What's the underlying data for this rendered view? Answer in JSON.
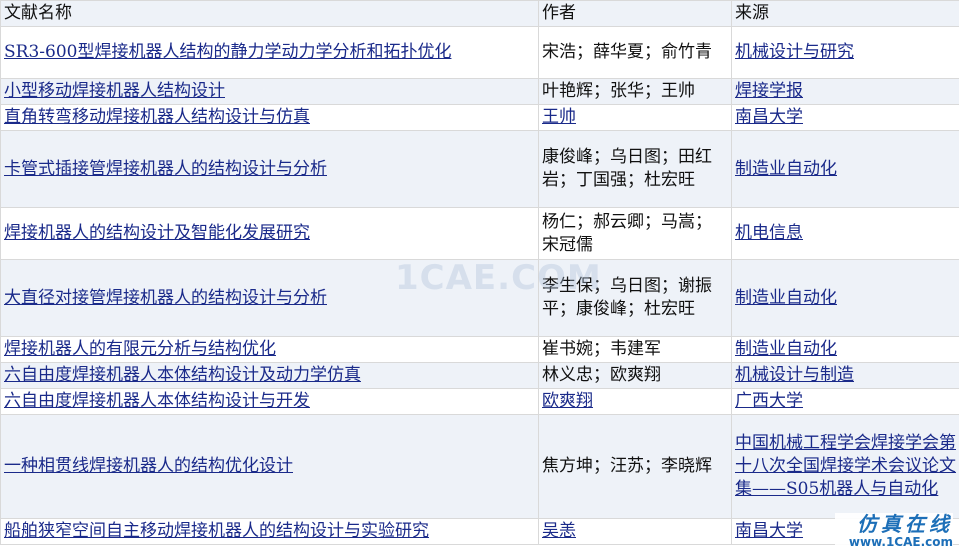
{
  "headers": {
    "title": "文献名称",
    "authors": "作者",
    "source": "来源"
  },
  "rows": [
    {
      "title": "SR3-600型焊接机器人结构的静力学动力学分析和拓扑优化",
      "authors": "宋浩；薛华夏；俞竹青",
      "source": "机械设计与研究"
    },
    {
      "title": "小型移动焊接机器人结构设计",
      "authors": "叶艳辉；张华；王帅",
      "source": "焊接学报"
    },
    {
      "title": "直角转弯移动焊接机器人结构设计与仿真",
      "authors": "王帅",
      "source": "南昌大学"
    },
    {
      "title": "卡管式插接管焊接机器人的结构设计与分析",
      "authors": "康俊峰；乌日图；田红岩；丁国强；杜宏旺",
      "source": "制造业自动化"
    },
    {
      "title": "焊接机器人的结构设计及智能化发展研究",
      "authors": "杨仁；郝云卿；马嵩；宋冠儒",
      "source": "机电信息"
    },
    {
      "title": "大直径对接管焊接机器人的结构设计与分析",
      "authors": "李生保；乌日图；谢振平；康俊峰；杜宏旺",
      "source": "制造业自动化"
    },
    {
      "title": "焊接机器人的有限元分析与结构优化",
      "authors": "崔书婉；韦建军",
      "source": "制造业自动化"
    },
    {
      "title": "六自由度焊接机器人本体结构设计及动力学仿真",
      "authors": "林义忠；欧爽翔",
      "source": "机械设计与制造"
    },
    {
      "title": "六自由度焊接机器人本体结构设计与开发",
      "authors": "欧爽翔",
      "source": "广西大学"
    },
    {
      "title": "一种相贯线焊接机器人的结构优化设计",
      "authors": "焦方坤；汪苏；李晓辉",
      "source": "中国机械工程学会焊接学会第十八次全国焊接学术会议论文集——S05机器人与自动化"
    },
    {
      "title": "船舶狭窄空间自主移动焊接机器人的结构设计与实验研究",
      "authors": "吴恙",
      "source": "南昌大学"
    }
  ],
  "watermark": "1CAE.COM",
  "corner_logo": {
    "line1": "仿真在线",
    "line2": "www.1CAE.com"
  }
}
